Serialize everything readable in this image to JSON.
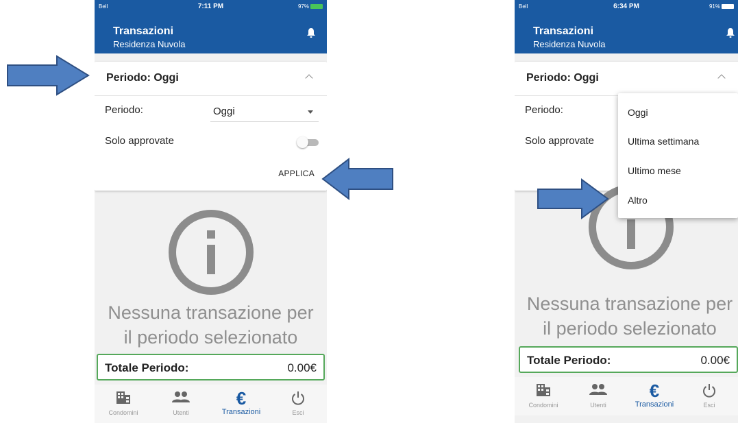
{
  "left_screen": {
    "status": {
      "carrier": "Bell",
      "time": "7:11 PM",
      "battery": "97%"
    },
    "header": {
      "title": "Transazioni",
      "subtitle": "Residenza Nuvola"
    },
    "card": {
      "title": "Periodo: Oggi",
      "period_label": "Periodo:",
      "period_value": "Oggi",
      "approved_label": "Solo approvate",
      "apply_label": "APPLICA"
    },
    "empty_message_line1": "Nessuna transazione per",
    "empty_message_line2": "il periodo selezionato",
    "total": {
      "label": "Totale Periodo:",
      "value": "0.00€"
    }
  },
  "right_screen": {
    "status": {
      "carrier": "Bell",
      "time": "6:34 PM",
      "battery": "91%"
    },
    "header": {
      "title": "Transazioni",
      "subtitle": "Residenza Nuvola"
    },
    "card": {
      "title": "Periodo: Oggi",
      "period_label": "Periodo:",
      "approved_label": "Solo approvate"
    },
    "dropdown_options": [
      "Oggi",
      "Ultima settimana",
      "Ultimo mese",
      "Altro"
    ],
    "empty_message_line1": "Nessuna transazione per",
    "empty_message_line2": "il periodo selezionato",
    "total": {
      "label": "Totale Periodo:",
      "value": "0.00€"
    }
  },
  "tabs": [
    "Condomini",
    "Utenti",
    "Transazioni",
    "Esci"
  ],
  "active_tab": "Transazioni",
  "icons": {
    "header": "bell-icon",
    "tabs": [
      "building-icon",
      "users-icon",
      "euro-icon",
      "power-icon"
    ],
    "empty_state": "info-icon",
    "annotations": "arrow-icon"
  },
  "colors": {
    "header_blue": "#1a5aa2",
    "total_border_green": "#55a85a",
    "annotation_arrow": "#4f7fc1",
    "empty_text_gray": "#8f8f8f"
  }
}
